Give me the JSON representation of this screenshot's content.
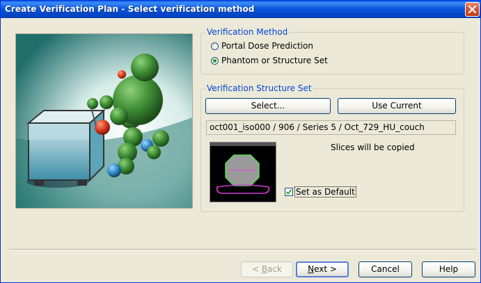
{
  "window": {
    "title": "Create Verification Plan  - Select verification method"
  },
  "icons": {
    "close": "close-icon",
    "illustration": "robot-illustration-icon",
    "thumbnail": "ct-slice-preview-icon",
    "check": "checkmark-icon"
  },
  "verification_method": {
    "legend": "Verification Method",
    "options": [
      {
        "label": "Portal Dose Prediction",
        "selected": false
      },
      {
        "label": "Phantom or Structure Set",
        "selected": true
      }
    ]
  },
  "verification_structure_set": {
    "legend": "Verification Structure Set",
    "select_label": "Select...",
    "use_current_label": "Use Current",
    "path": "oct001_iso000 / 906 / Series 5 / Oct_729_HU_couch",
    "slices_note": "Slices will be copied",
    "set_default_label": "Set as Default",
    "set_default_checked": true
  },
  "footer": {
    "back_prefix": "< ",
    "back_mnemonic": "B",
    "back_rest": "ack",
    "next_mnemonic": "N",
    "next_rest": "ext >",
    "cancel_label": "Cancel",
    "help_label": "Help"
  },
  "colors": {
    "titlebar": "#0a58dc",
    "group_legend": "#0046d5",
    "dialog_bg": "#ece9d8",
    "close_button": "#d6532f"
  }
}
